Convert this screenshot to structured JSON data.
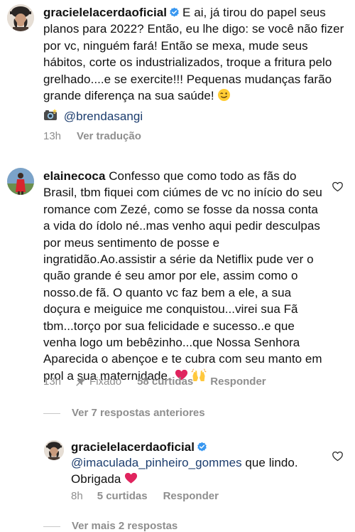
{
  "comments": [
    {
      "username": "gracielelacerdaoficial",
      "text": "E ai, já tirou do papel seus planos para 2022? Então, eu lhe digo: se você não fizer por vc, ninguém fará! Então se mexa, mude seus hábitos, corte os industrializados, troque a fritura pelo grelhado....e se exercite!!! Pequenas mudanças farão grande diferença na sua saúde!",
      "credit_mention": "@brendasangi",
      "time": "13h",
      "translate": "Ver tradução"
    },
    {
      "username": "elainecoca",
      "text": "Confesso que como todo as fãs do Brasil, tbm fiquei com ciúmes de vc no início do seu romance com Zezé, como se fosse da nossa conta a vida do ídolo né..mas venho aqui pedir desculpas por meus sentimento de posse e ingratidão.Ao.assistir a série da Netiflix pude ver o quão grande é seu amor por ele, assim como o nosso.de fã. O quanto vc faz bem a ele, a sua doçura e meiguice me conquistou...virei sua Fã tbm...torço por sua felicidade e sucesso..e que venha logo um bebêzinho...que Nossa Senhora Aparecida o abençoe e te cubra com seu manto em prol a sua maternidade.",
      "time": "13h",
      "pinned": "Fixado",
      "likes": "58 curtidas",
      "reply": "Responder"
    }
  ],
  "view_replies": "Ver 7 respostas anteriores",
  "reply": {
    "username": "gracielelacerdaoficial",
    "mention": "@imaculada_pinheiro_gommes",
    "text": "que lindo. Obrigada",
    "time": "8h",
    "likes": "5 curtidas",
    "reply_label": "Responder"
  },
  "cut_off_text": "Ver mais 2 respostas",
  "icons": {
    "verified": "verified-badge-icon",
    "heart": "heart-outline-icon",
    "pin": "pin-icon",
    "camera": "camera-emoji-icon"
  },
  "colors": {
    "text": "#111111",
    "meta": "#8e8e8e",
    "verified": "#3897f0",
    "mention": "#1c3d6e",
    "red_heart": "#e0245e"
  }
}
